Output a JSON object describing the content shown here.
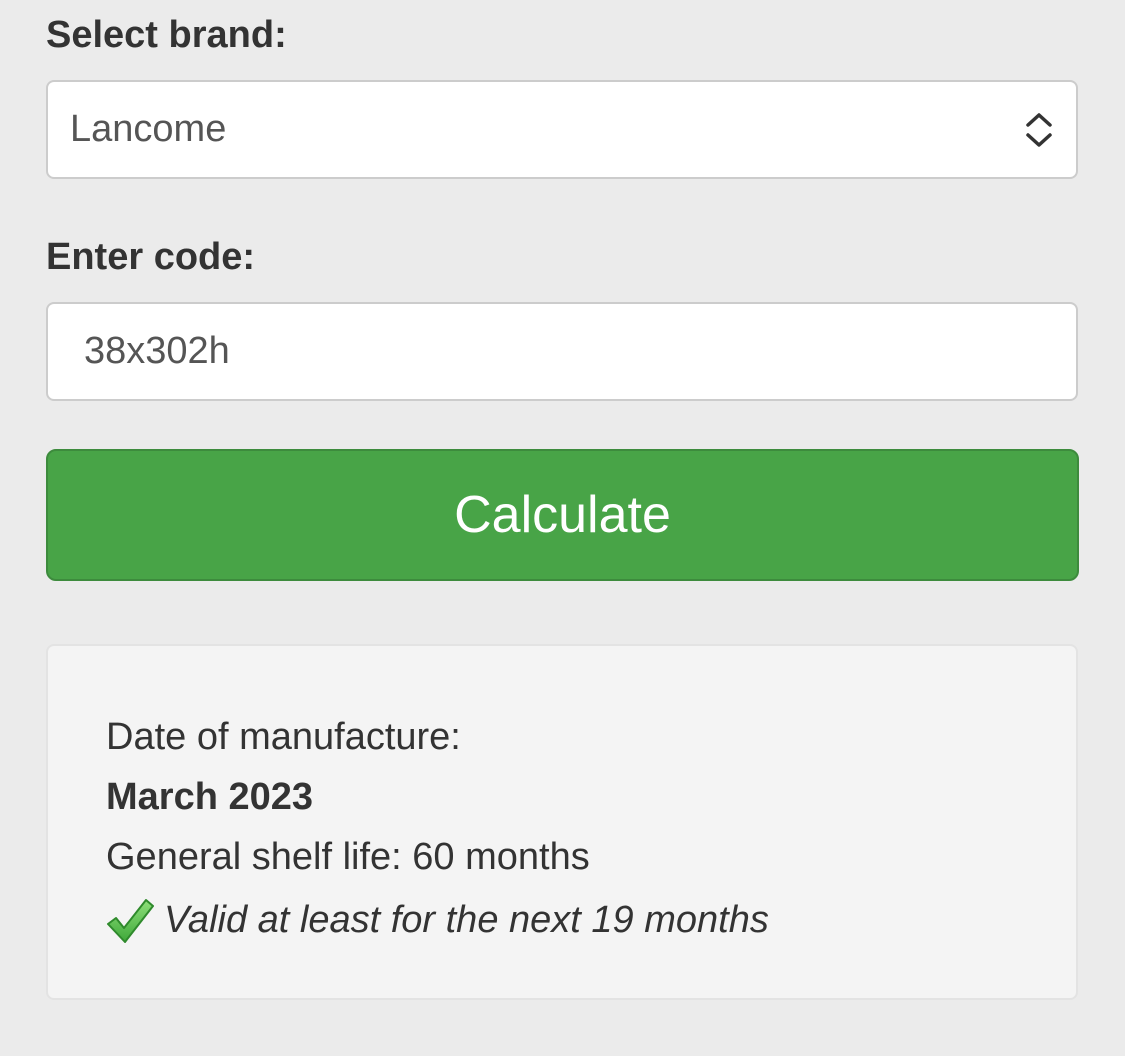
{
  "form": {
    "brand_label": "Select brand:",
    "brand_selected": "Lancome",
    "code_label": "Enter code:",
    "code_value": "38x302h",
    "calculate_label": "Calculate"
  },
  "result": {
    "date_label": "Date of manufacture:",
    "date_value": "March 2023",
    "shelf_life": "General shelf life: 60 months",
    "validity": "Valid at least for the next 19 months"
  },
  "icons": {
    "select_arrows": "chevron-up-down-icon",
    "validity": "checkmark-icon"
  },
  "colors": {
    "background": "#ebebeb",
    "button_green": "#48a447",
    "check_green": "#5cc04b",
    "text": "#333333"
  }
}
